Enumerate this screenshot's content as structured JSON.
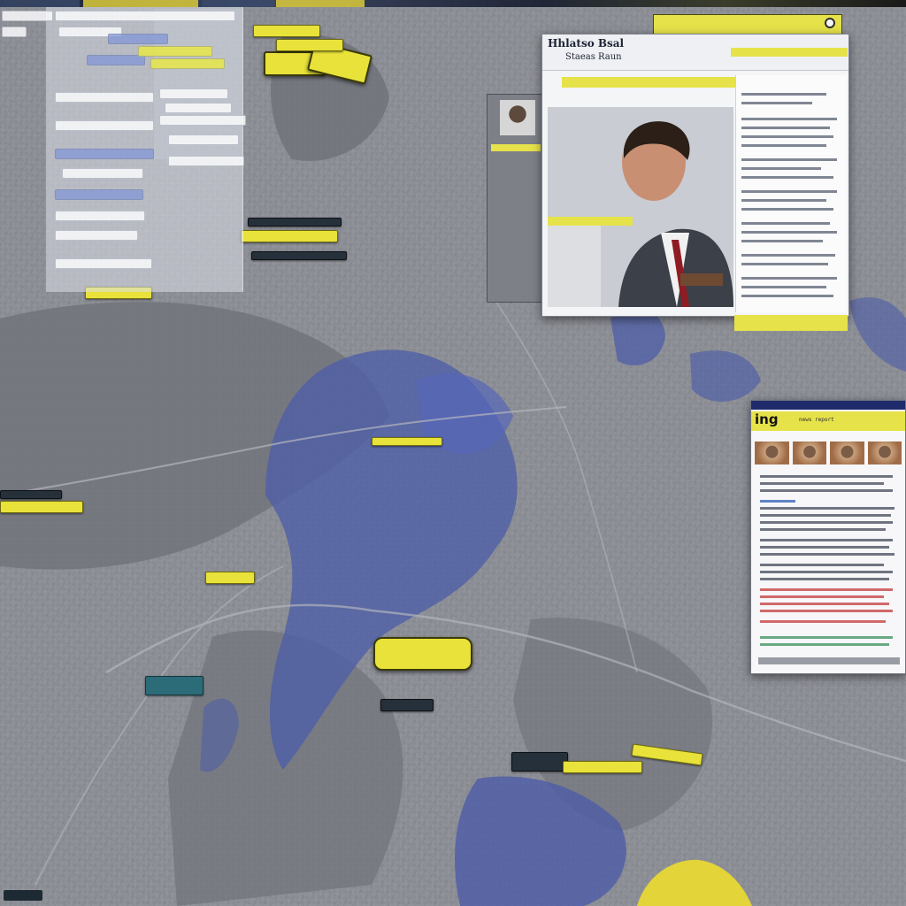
{
  "news_window": {
    "title": "Hhlatso Bsal",
    "subtitle": "Staeas Raun",
    "accent_color": "#e6e24a",
    "header_color": "#1f2b4d"
  },
  "article_panel": {
    "brand": "ing",
    "headline": "news report"
  },
  "colors": {
    "water": "#4f5fae",
    "land": "#8a8c93",
    "marker_yellow": "#e8e23a",
    "panel_bg": "#f4f5f7"
  },
  "icons": {
    "close": "close-icon"
  }
}
